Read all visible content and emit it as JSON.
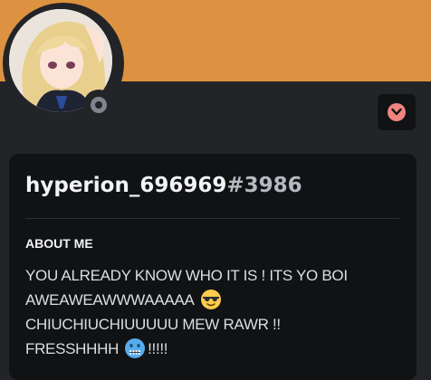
{
  "profile": {
    "username": "hyperion_696969",
    "discriminator": "#3986",
    "banner_color": "#DC9240",
    "status": "offline",
    "avatar": "anime-avatar"
  },
  "about": {
    "heading": "ABOUT ME",
    "line1": "YOU ALREADY KNOW WHO IT IS ! ITS YO BOI",
    "line2": "AWEAWEAWWWAAAAA",
    "line3": "CHIUCHIUCHIUUUUU MEW  RAWR !!",
    "line4a": "FRESSHHHH",
    "line4b": "!!!!!",
    "emoji1": "sunglasses-emoji",
    "emoji2": "cold-face-emoji"
  },
  "menu": {
    "icon": "chevron-down-icon"
  }
}
